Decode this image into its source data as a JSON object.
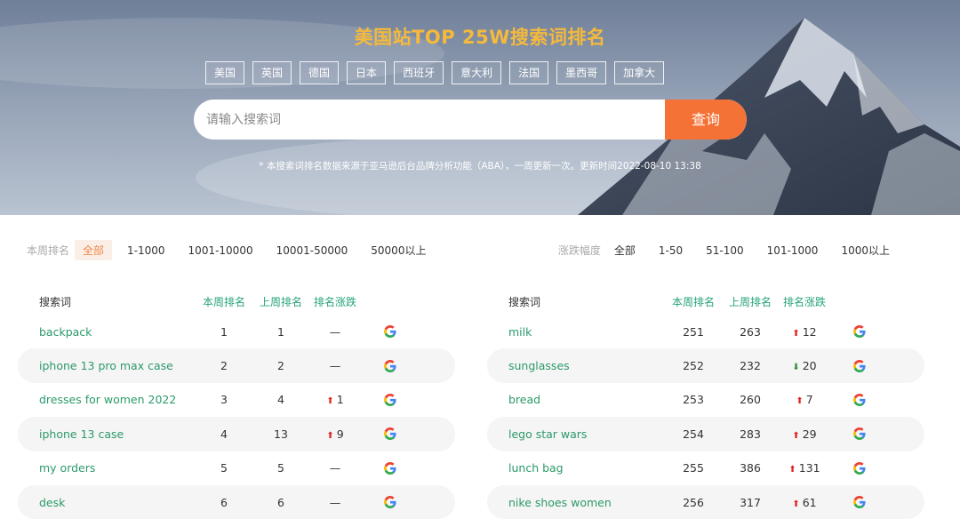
{
  "hero": {
    "title": "美国站TOP 25W搜索词排名",
    "countries": [
      "美国",
      "英国",
      "德国",
      "日本",
      "西班牙",
      "意大利",
      "法国",
      "墨西哥",
      "加拿大"
    ],
    "search_placeholder": "请输入搜索词",
    "search_button": "查询",
    "note": "* 本搜索词排名数据来源于亚马逊后台品牌分析功能（ABA），一周更新一次。更新时间2022-08-10 13:38"
  },
  "filters": {
    "rank": {
      "label": "本周排名",
      "options": [
        "全部",
        "1-1000",
        "1001-10000",
        "10001-50000",
        "50000以上"
      ],
      "active": "全部"
    },
    "change": {
      "label": "涨跌幅度",
      "options": [
        "全部",
        "1-50",
        "51-100",
        "101-1000",
        "1000以上"
      ],
      "active": ""
    }
  },
  "columns": {
    "keyword": "搜索词",
    "current": "本周排名",
    "previous": "上周排名",
    "change": "排名涨跌"
  },
  "left_rows": [
    {
      "keyword": "backpack",
      "current": "1",
      "previous": "1",
      "dir": "none",
      "change": "—"
    },
    {
      "keyword": "iphone 13 pro max case",
      "current": "2",
      "previous": "2",
      "dir": "none",
      "change": "—"
    },
    {
      "keyword": "dresses for women 2022",
      "current": "3",
      "previous": "4",
      "dir": "up",
      "change": "1"
    },
    {
      "keyword": "iphone 13 case",
      "current": "4",
      "previous": "13",
      "dir": "up",
      "change": "9"
    },
    {
      "keyword": "my orders",
      "current": "5",
      "previous": "5",
      "dir": "none",
      "change": "—"
    },
    {
      "keyword": "desk",
      "current": "6",
      "previous": "6",
      "dir": "none",
      "change": "—"
    }
  ],
  "right_rows": [
    {
      "keyword": "milk",
      "current": "251",
      "previous": "263",
      "dir": "up",
      "change": "12"
    },
    {
      "keyword": "sunglasses",
      "current": "252",
      "previous": "232",
      "dir": "down",
      "change": "20"
    },
    {
      "keyword": "bread",
      "current": "253",
      "previous": "260",
      "dir": "up",
      "change": "7"
    },
    {
      "keyword": "lego star wars",
      "current": "254",
      "previous": "283",
      "dir": "up",
      "change": "29"
    },
    {
      "keyword": "lunch bag",
      "current": "255",
      "previous": "386",
      "dir": "up",
      "change": "131"
    },
    {
      "keyword": "nike shoes women",
      "current": "256",
      "previous": "317",
      "dir": "up",
      "change": "61"
    }
  ],
  "colors": {
    "accent": "#f57236",
    "title": "#f5b93c",
    "keyword": "#2b9a6a",
    "up": "#e02020",
    "down": "#2e8b3a"
  },
  "icons": {
    "up": "arrow-up-icon",
    "down": "arrow-down-icon",
    "search_engine": "google-icon"
  }
}
